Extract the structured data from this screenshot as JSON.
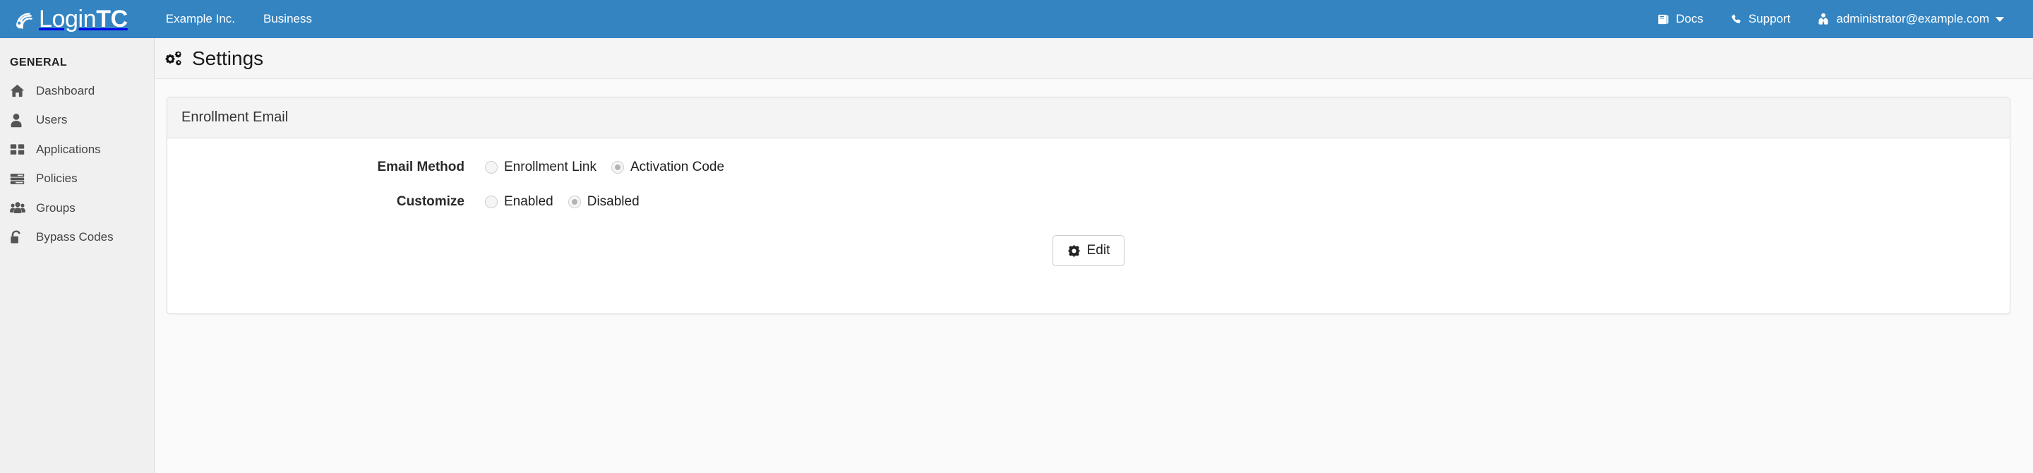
{
  "colors": {
    "navbar_bg": "#3484c2",
    "sidebar_bg": "#f0f0f0",
    "content_bg": "#fafafa",
    "panel_header_bg": "#f4f4f4",
    "panel_border": "#dddddd",
    "nav_text": "#ffffff"
  },
  "navbar": {
    "brand": {
      "icon": "signal-waves-icon",
      "text_light": "Login",
      "text_bold": "TC"
    },
    "left_links": [
      {
        "label": "Example Inc.",
        "name": "nav-link-example-inc"
      },
      {
        "label": "Business",
        "name": "nav-link-business"
      }
    ],
    "right_links": [
      {
        "label": "Docs",
        "icon": "book-icon",
        "name": "nav-link-docs"
      },
      {
        "label": "Support",
        "icon": "phone-icon",
        "name": "nav-link-support"
      }
    ],
    "account": {
      "label": "administrator@example.com",
      "icon": "user-tie-icon",
      "caret": "chevron-down-icon"
    }
  },
  "sidebar": {
    "heading": "GENERAL",
    "items": [
      {
        "label": "Dashboard",
        "icon": "home-icon"
      },
      {
        "label": "Users",
        "icon": "user-icon"
      },
      {
        "label": "Applications",
        "icon": "th-large-icon"
      },
      {
        "label": "Policies",
        "icon": "list-server-icon"
      },
      {
        "label": "Groups",
        "icon": "users-icon"
      },
      {
        "label": "Bypass Codes",
        "icon": "unlock-icon"
      }
    ]
  },
  "page": {
    "title": "Settings",
    "title_icon": "cogs-icon"
  },
  "panel": {
    "title": "Enrollment Email",
    "rows": [
      {
        "label": "Email Method",
        "options": [
          {
            "label": "Enrollment Link",
            "selected": false
          },
          {
            "label": "Activation Code",
            "selected": true
          }
        ]
      },
      {
        "label": "Customize",
        "options": [
          {
            "label": "Enabled",
            "selected": false
          },
          {
            "label": "Disabled",
            "selected": true
          }
        ]
      }
    ],
    "edit_button": {
      "label": "Edit",
      "icon": "cog-icon"
    }
  }
}
